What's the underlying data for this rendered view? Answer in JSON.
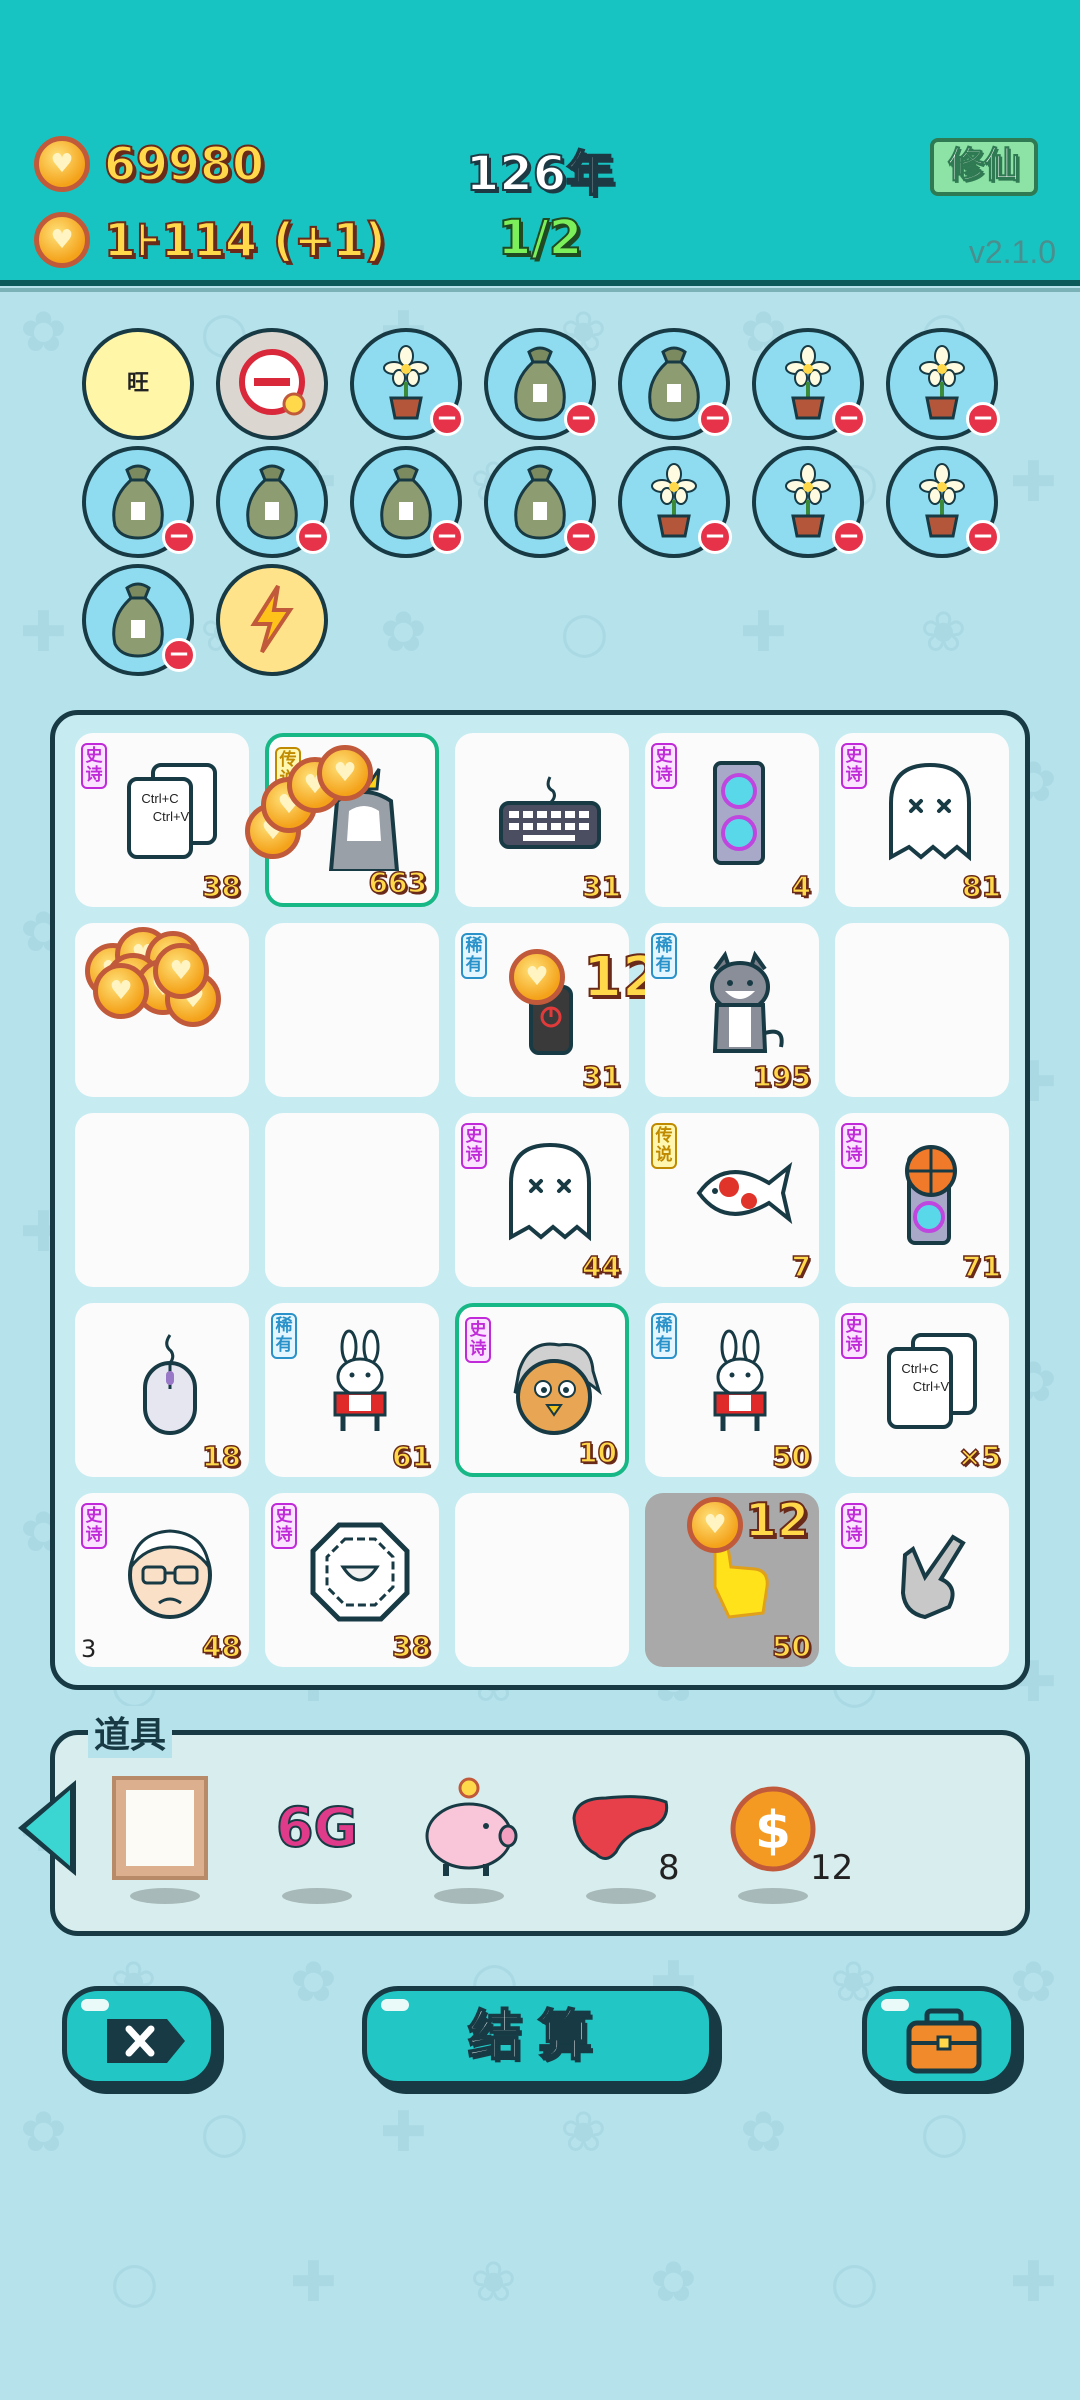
{
  "header": {
    "gold": "69980",
    "income": "1⊦114 (+1)",
    "year": "126年",
    "round": "1/2",
    "xiuxian_label": "修仙",
    "version": "v2.1.0"
  },
  "active_items": [
    {
      "icon": "wang-symbol-icon",
      "text": "旺"
    },
    {
      "icon": "no-entry-icon"
    },
    {
      "icon": "flower-pot-icon"
    },
    {
      "icon": "money-bag-icon"
    },
    {
      "icon": "money-bag-icon"
    },
    {
      "icon": "flower-pot-icon"
    },
    {
      "icon": "flower-pot-icon"
    },
    {
      "icon": "money-bag-icon"
    },
    {
      "icon": "money-bag-icon"
    },
    {
      "icon": "money-bag-icon"
    },
    {
      "icon": "money-bag-icon"
    },
    {
      "icon": "flower-pot-icon"
    },
    {
      "icon": "flower-pot-icon"
    },
    {
      "icon": "flower-pot-icon"
    },
    {
      "icon": "money-bag-icon"
    },
    {
      "icon": "lightning-icon"
    }
  ],
  "board": {
    "rarity_labels": {
      "shishi": "史诗",
      "chuanshuo": "传说",
      "xiyou": "稀有"
    },
    "cells": [
      {
        "item": "copy-paste-icon",
        "rarity": "shishi",
        "count": "38",
        "copy_text": "Ctrl+C",
        "paste_text": "Ctrl+V"
      },
      {
        "item": "crowned-cat-icon",
        "rarity": "chuanshuo",
        "count": "663",
        "highlight": true
      },
      {
        "item": "keyboard-icon",
        "rarity": "",
        "count": "31"
      },
      {
        "item": "graphics-card-icon",
        "rarity": "shishi",
        "count": "4"
      },
      {
        "item": "ghost-icon",
        "rarity": "shishi",
        "count": "81"
      },
      {
        "item": "coin-pile",
        "rarity": "",
        "count": ""
      },
      {
        "item": "empty",
        "rarity": "",
        "count": ""
      },
      {
        "item": "power-button-icon",
        "rarity": "xiyou",
        "count": "31",
        "gain": "12"
      },
      {
        "item": "husky-dog-icon",
        "rarity": "xiyou",
        "count": "195"
      },
      {
        "item": "empty",
        "rarity": "",
        "count": ""
      },
      {
        "item": "empty",
        "rarity": "",
        "count": ""
      },
      {
        "item": "empty",
        "rarity": "",
        "count": ""
      },
      {
        "item": "ghost-icon",
        "rarity": "shishi",
        "count": "44"
      },
      {
        "item": "koi-fish-icon",
        "rarity": "chuanshuo",
        "count": "7"
      },
      {
        "item": "basketball-gpu-icon",
        "rarity": "shishi",
        "count": "71"
      },
      {
        "item": "mouse-icon",
        "rarity": "",
        "count": "18"
      },
      {
        "item": "rabbit-icon",
        "rarity": "xiyou",
        "count": "61"
      },
      {
        "item": "angry-bird-icon",
        "rarity": "shishi",
        "count": "10",
        "highlight": true
      },
      {
        "item": "rabbit-icon",
        "rarity": "xiyou",
        "count": "50"
      },
      {
        "item": "copy-paste-icon",
        "rarity": "shishi",
        "count": "×5",
        "copy_text": "Ctrl+C",
        "paste_text": "Ctrl+V"
      },
      {
        "item": "old-man-icon",
        "rarity": "shishi",
        "count": "48",
        "left_count": "3"
      },
      {
        "item": "bagua-icon",
        "rarity": "shishi",
        "count": "38"
      },
      {
        "item": "empty",
        "rarity": "",
        "count": ""
      },
      {
        "item": "yellow-hand-icon",
        "rarity": "",
        "count": "50",
        "gain": "12",
        "gray": true
      },
      {
        "item": "gray-hand-icon",
        "rarity": "shishi",
        "count": ""
      }
    ]
  },
  "props": {
    "title": "道具",
    "items": [
      {
        "icon": "frame-icon",
        "count": ""
      },
      {
        "icon": "6g-icon",
        "label": "6G",
        "count": ""
      },
      {
        "icon": "piggy-bank-icon",
        "count": ""
      },
      {
        "icon": "liver-icon",
        "count": "8"
      },
      {
        "icon": "dollar-coin-icon",
        "label": "$",
        "count": "12"
      }
    ]
  },
  "buttons": {
    "settle_label": "结算"
  },
  "colors": {
    "header_bg": "#18c4c2",
    "page_bg": "#b6e2ec",
    "accent_gold": "#ffd94a",
    "outline": "#173a44",
    "progress_green": "#7cf05a"
  }
}
